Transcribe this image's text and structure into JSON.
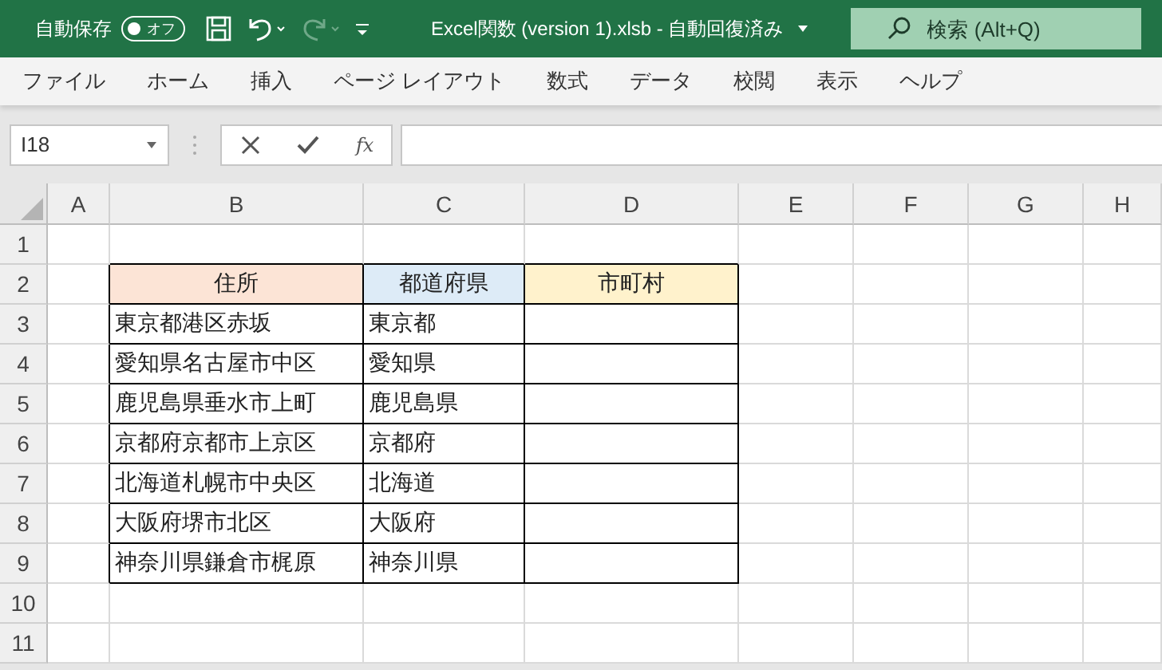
{
  "title_bar": {
    "autosave": {
      "label": "自動保存",
      "toggle_text": "オフ",
      "on": false
    },
    "quick_access": [
      {
        "kind": "save",
        "disabled": false
      },
      {
        "kind": "undo",
        "disabled": false
      },
      {
        "kind": "redo",
        "disabled": true
      },
      {
        "kind": "customize",
        "disabled": false
      }
    ],
    "title": "Excel関数 (version 1).xlsb  -  自動回復済み",
    "search": {
      "placeholder": "検索 (Alt+Q)"
    }
  },
  "menu": [
    "ファイル",
    "ホーム",
    "挿入",
    "ページ レイアウト",
    "数式",
    "データ",
    "校閲",
    "表示",
    "ヘルプ"
  ],
  "formula_bar": {
    "name_box": "I18",
    "function_label": "fx"
  },
  "sheet": {
    "columns": [
      "A",
      "B",
      "C",
      "D",
      "E",
      "F",
      "G",
      "H"
    ],
    "row_numbers": [
      "1",
      "2",
      "3",
      "4",
      "5",
      "6",
      "7",
      "8",
      "9",
      "10",
      "11"
    ],
    "table": {
      "headers": [
        {
          "text": "住所",
          "color": "#fce4d6"
        },
        {
          "text": "都道府県",
          "color": "#ddebf7"
        },
        {
          "text": "市町村",
          "color": "#fff2cc"
        }
      ],
      "rows": [
        {
          "address": "東京都港区赤坂",
          "prefecture": "東京都"
        },
        {
          "address": "愛知県名古屋市中区",
          "prefecture": "愛知県"
        },
        {
          "address": "鹿児島県垂水市上町",
          "prefecture": "鹿児島県"
        },
        {
          "address": "京都府京都市上京区",
          "prefecture": "京都府"
        },
        {
          "address": "北海道札幌市中央区",
          "prefecture": "北海道"
        },
        {
          "address": "大阪府堺市北区",
          "prefecture": "大阪府"
        },
        {
          "address": "神奈川県鎌倉市梶原",
          "prefecture": "神奈川県"
        }
      ]
    }
  }
}
